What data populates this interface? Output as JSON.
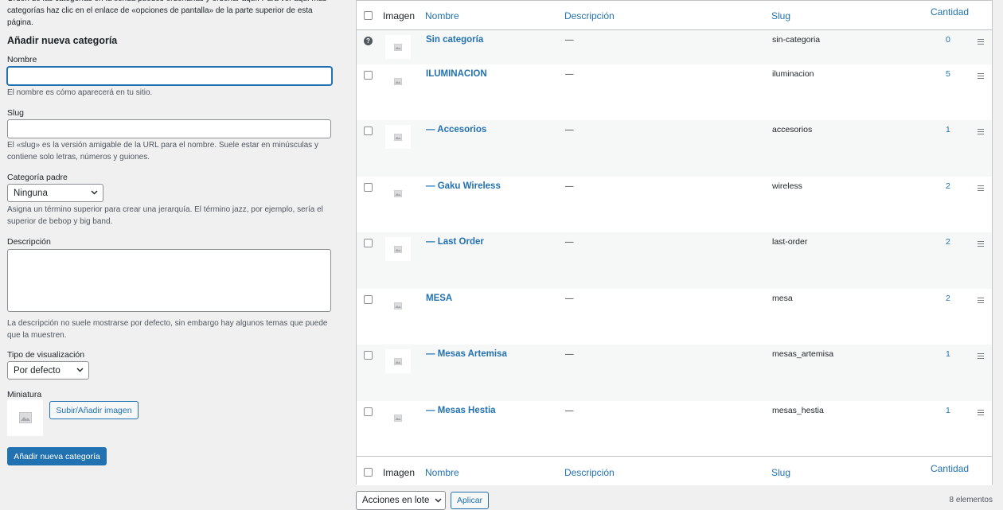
{
  "form": {
    "intro": "Orden de las categorías en la tienda puedes ordenarlas y ordenar aquí. Para ver aquí más categorías haz clic en el enlace de «opciones de pantalla» de la parte superior de esta página.",
    "title": "Añadir nueva categoría",
    "name_label": "Nombre",
    "name_value": "",
    "name_help": "El nombre es cómo aparecerá en tu sitio.",
    "slug_label": "Slug",
    "slug_value": "",
    "slug_help": "El «slug» es la versión amigable de la URL para el nombre. Suele estar en minúsculas y contiene solo letras, números y guiones.",
    "parent_label": "Categoría padre",
    "parent_value": "Ninguna",
    "parent_help": "Asigna un término superior para crear una jerarquía. El término jazz, por ejemplo, sería el superior de bebop y big band.",
    "desc_label": "Descripción",
    "desc_help": "La descripción no suele mostrarse por defecto, sin embargo hay algunos temas que puede que la muestren.",
    "display_label": "Tipo de visualización",
    "display_value": "Por defecto",
    "thumb_label": "Miniatura",
    "upload_button": "Subir/Añadir imagen",
    "submit_button": "Añadir nueva categoría"
  },
  "table": {
    "columns": {
      "image": "Imagen",
      "name": "Nombre",
      "description": "Descripción",
      "slug": "Slug",
      "count": "Cantidad"
    },
    "rows": [
      {
        "name": "Sin categoría",
        "description": "—",
        "slug": "sin-categoria",
        "count": "0"
      },
      {
        "name": "ILUMINACION",
        "description": "—",
        "slug": "iluminacion",
        "count": "5"
      },
      {
        "name": "— Accesorios",
        "description": "—",
        "slug": "accesorios",
        "count": "1"
      },
      {
        "name": "— Gaku Wireless",
        "description": "—",
        "slug": "wireless",
        "count": "2"
      },
      {
        "name": "— Last Order",
        "description": "—",
        "slug": "last-order",
        "count": "2"
      },
      {
        "name": "MESA",
        "description": "—",
        "slug": "mesa",
        "count": "2"
      },
      {
        "name": "— Mesas Artemisa",
        "description": "—",
        "slug": "mesas_artemisa",
        "count": "1"
      },
      {
        "name": "— Mesas Hestia",
        "description": "—",
        "slug": "mesas_hestia",
        "count": "1"
      }
    ]
  },
  "footer": {
    "bulk_actions": "Acciones en lote",
    "apply": "Aplicar",
    "items_count": "8 elementos"
  },
  "icons": {
    "help": "?",
    "chevron": "⌄"
  },
  "colors": {
    "accent": "#2271b1",
    "background": "#f0f0f1"
  }
}
